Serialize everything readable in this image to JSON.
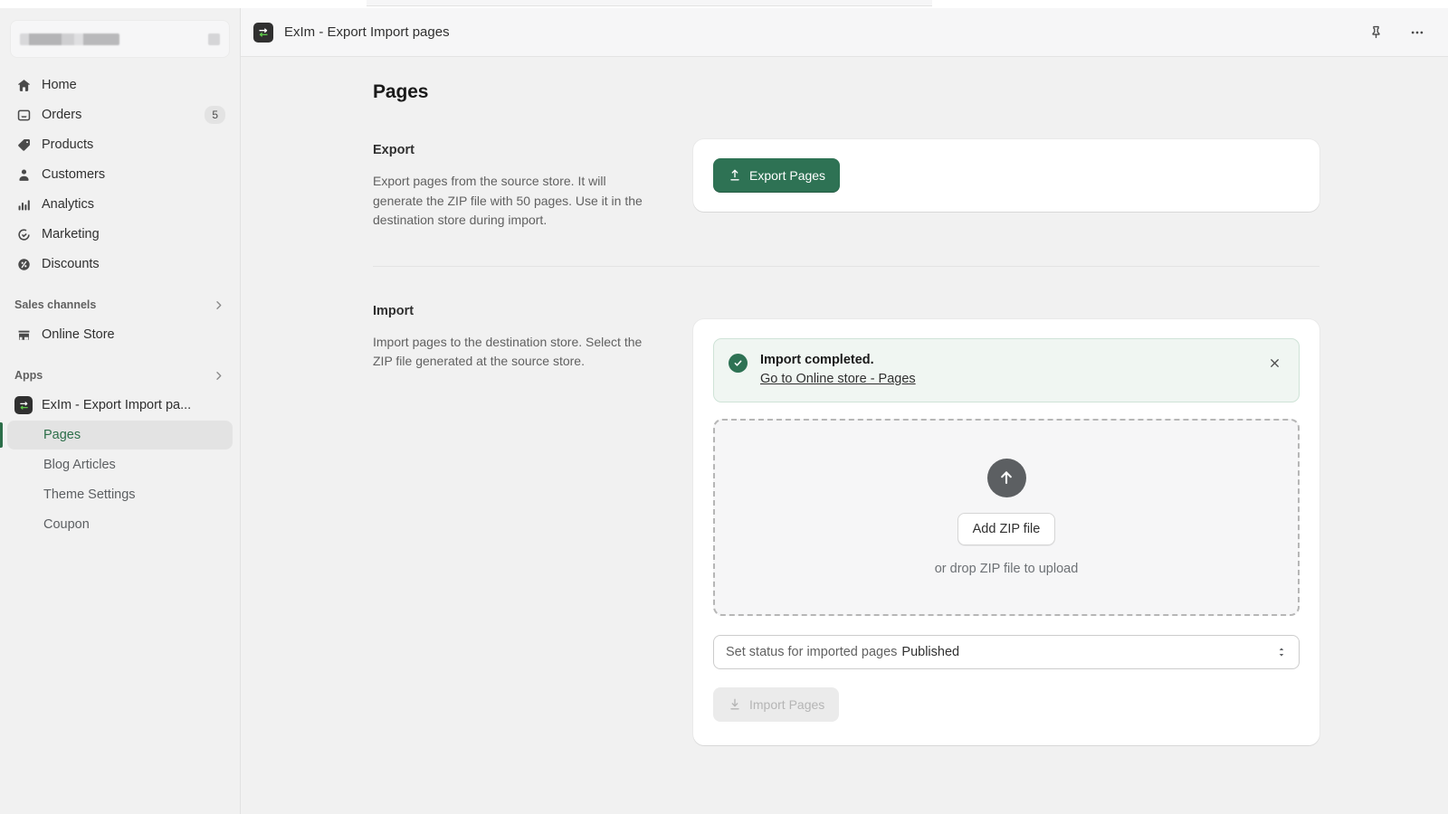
{
  "sidebar": {
    "store_switcher": {
      "name_redacted": true,
      "icon": "chevron-updown-icon"
    },
    "nav_items": [
      {
        "label": "Home",
        "icon": "home-icon",
        "badge": ""
      },
      {
        "label": "Orders",
        "icon": "orders-inbox-icon",
        "badge": "5"
      },
      {
        "label": "Products",
        "icon": "products-tag-icon",
        "badge": ""
      },
      {
        "label": "Customers",
        "icon": "customers-person-icon",
        "badge": ""
      },
      {
        "label": "Analytics",
        "icon": "analytics-bars-icon",
        "badge": ""
      },
      {
        "label": "Marketing",
        "icon": "marketing-target-icon",
        "badge": ""
      },
      {
        "label": "Discounts",
        "icon": "discounts-percent-icon",
        "badge": ""
      }
    ],
    "sales_channels": {
      "heading": "Sales channels",
      "chevron": "chevron-right-icon",
      "items": [
        {
          "label": "Online Store",
          "icon": "storefront-icon"
        }
      ]
    },
    "apps": {
      "heading": "Apps",
      "chevron": "chevron-right-icon",
      "app": {
        "label": "ExIm - Export Import pa...",
        "icon": "exim-app-icon"
      },
      "sub_items": [
        {
          "label": "Pages",
          "active": true
        },
        {
          "label": "Blog Articles",
          "active": false
        },
        {
          "label": "Theme Settings",
          "active": false
        },
        {
          "label": "Coupon",
          "active": false
        }
      ]
    }
  },
  "header": {
    "app_icon": "exim-app-icon",
    "title": "ExIm - Export Import pages",
    "pin_icon": "pin-icon",
    "more_icon": "more-horizontal-icon"
  },
  "page": {
    "title": "Pages"
  },
  "export_section": {
    "heading": "Export",
    "description": "Export pages from the source store. It will generate the ZIP file with 50 pages. Use it in the destination store during import.",
    "button_label": "Export Pages",
    "button_icon": "upload-arrow-icon"
  },
  "import_section": {
    "heading": "Import",
    "description": "Import pages to the destination store. Select the ZIP file generated at the source store.",
    "banner": {
      "icon": "check-circle-icon",
      "title": "Import completed.",
      "link_label": "Go to Online store - Pages",
      "close_icon": "close-icon"
    },
    "dropzone": {
      "upload_icon": "upload-circle-arrow-icon",
      "add_button_label": "Add ZIP file",
      "hint": "or drop ZIP file to upload"
    },
    "status_select": {
      "label": "Set status for imported pages",
      "value": "Published",
      "caret_icon": "chevron-updown-icon"
    },
    "import_button": {
      "label": "Import Pages",
      "icon": "download-arrow-icon",
      "disabled": true
    }
  },
  "colors": {
    "brand_green": "#2e7254",
    "banner_bg": "#f0f6f2",
    "banner_border": "#cfe3d7",
    "sidebar_bg": "#f1f1f1",
    "card_bg": "#ffffff",
    "active_sub_item": "#2c6e49"
  }
}
